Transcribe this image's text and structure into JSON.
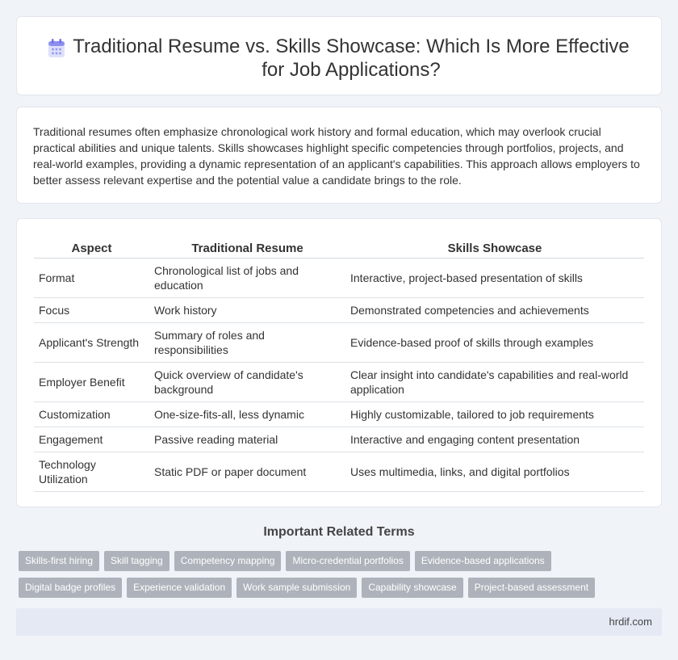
{
  "header": {
    "title": "Traditional Resume vs. Skills Showcase: Which Is More Effective for Job Applications?",
    "icon": "calendar-icon"
  },
  "intro": {
    "text": "Traditional resumes often emphasize chronological work history and formal education, which may overlook crucial practical abilities and unique talents. Skills showcases highlight specific competencies through portfolios, projects, and real-world examples, providing a dynamic representation of an applicant's capabilities. This approach allows employers to better assess relevant expertise and the potential value a candidate brings to the role."
  },
  "table": {
    "headers": [
      "Aspect",
      "Traditional Resume",
      "Skills Showcase"
    ],
    "rows": [
      [
        "Format",
        "Chronological list of jobs and education",
        "Interactive, project-based presentation of skills"
      ],
      [
        "Focus",
        "Work history",
        "Demonstrated competencies and achievements"
      ],
      [
        "Applicant's Strength",
        "Summary of roles and responsibilities",
        "Evidence-based proof of skills through examples"
      ],
      [
        "Employer Benefit",
        "Quick overview of candidate's background",
        "Clear insight into candidate's capabilities and real-world application"
      ],
      [
        "Customization",
        "One-size-fits-all, less dynamic",
        "Highly customizable, tailored to job requirements"
      ],
      [
        "Engagement",
        "Passive reading material",
        "Interactive and engaging content presentation"
      ],
      [
        "Technology Utilization",
        "Static PDF or paper document",
        "Uses multimedia, links, and digital portfolios"
      ]
    ]
  },
  "related": {
    "title": "Important Related Terms",
    "tags_row1": [
      "Skills-first hiring",
      "Skill tagging",
      "Competency mapping",
      "Micro-credential portfolios",
      "Evidence-based applications"
    ],
    "tags_row2": [
      "Digital badge profiles",
      "Experience validation",
      "Work sample submission",
      "Capability showcase",
      "Project-based assessment"
    ]
  },
  "footer": {
    "site": "hrdif.com"
  },
  "colors": {
    "background": "#f0f3f8",
    "tag": "#aeb3bb",
    "footer": "#e4e9f4",
    "icon": "#8e8ff0"
  }
}
